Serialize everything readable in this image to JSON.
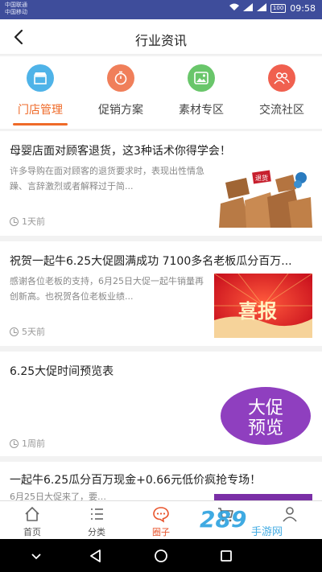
{
  "status_bar": {
    "carrier_1": "中国联通",
    "carrier_2": "中国移动",
    "battery": "100",
    "time": "09:58"
  },
  "header": {
    "title": "行业资讯"
  },
  "categories": [
    {
      "label": "门店管理",
      "icon": "store-icon",
      "color": "#4fb3e8",
      "active": true
    },
    {
      "label": "促销方案",
      "icon": "timer-icon",
      "color": "#f07f5a",
      "active": false
    },
    {
      "label": "素材专区",
      "icon": "image-icon",
      "color": "#69c66a",
      "active": false
    },
    {
      "label": "交流社区",
      "icon": "people-icon",
      "color": "#f0604f",
      "active": false
    }
  ],
  "articles": [
    {
      "title": "母婴店面对顾客退货，这3种话术你得学会！",
      "summary": "许多导购在面对顾客的退货要求时，表现出性情急躁、言辞激烈或者解释过于简...",
      "time": "1天前",
      "image_text": "退货"
    },
    {
      "title": "祝贺一起牛6.25大促圆满成功 7100多名老板瓜分百万...",
      "summary": "感谢各位老板的支持，6月25日大促一起牛销量再创新高。也祝贺各位老板业绩...",
      "time": "5天前",
      "image_text": "喜报"
    },
    {
      "title": "6.25大促时间预览表",
      "summary": "",
      "time": "1周前",
      "image_text_1": "大促",
      "image_text_2": "预览"
    },
    {
      "title": "一起牛6.25瓜分百万现金+0.66元低价疯抢专场！",
      "summary": "6月25日大促来了，要…",
      "time": ""
    }
  ],
  "tabbar": [
    {
      "label": "首页",
      "icon": "home-icon",
      "active": false
    },
    {
      "label": "分类",
      "icon": "list-icon",
      "active": false
    },
    {
      "label": "圈子",
      "icon": "chat-bubble-icon",
      "active": true
    },
    {
      "label": "购物车",
      "icon": "cart-icon",
      "active": false
    },
    {
      "label": "我的",
      "icon": "user-icon",
      "active": false
    }
  ],
  "watermark": {
    "text_1": "289",
    "text_2": "手游网"
  },
  "colors": {
    "accent": "#ef6a28",
    "status_bar": "#3e4d9b"
  }
}
